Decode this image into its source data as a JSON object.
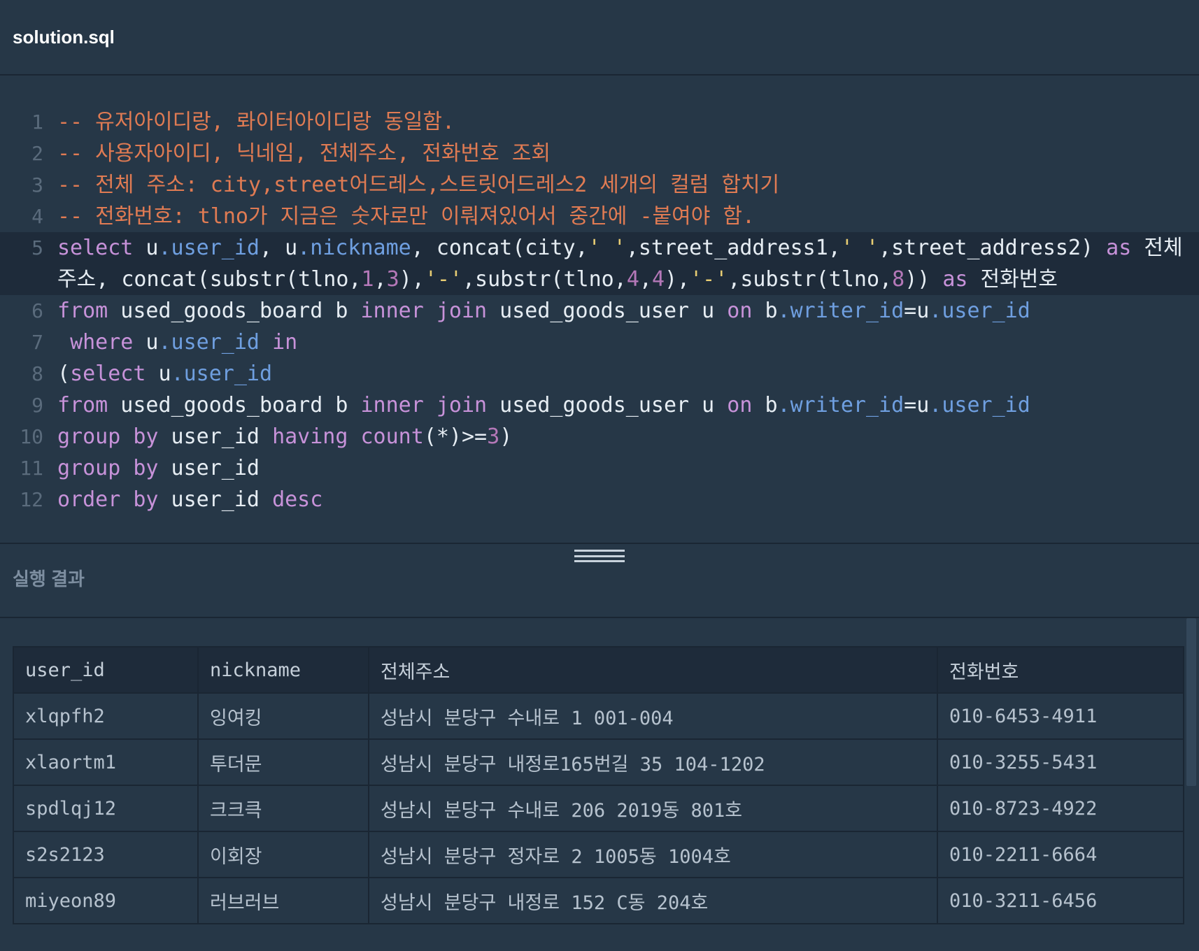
{
  "file": {
    "title": "solution.sql"
  },
  "editor": {
    "lines": [
      {
        "n": "1",
        "tokens": [
          {
            "t": "-- 유저아이디랑, 롸이터아이디랑 동일함.",
            "c": "cm"
          }
        ]
      },
      {
        "n": "2",
        "tokens": [
          {
            "t": "-- 사용자아이디, 닉네임, 전체주소, 전화번호 조회",
            "c": "cm"
          }
        ]
      },
      {
        "n": "3",
        "tokens": [
          {
            "t": "-- 전체 주소: city,street어드레스,스트릿어드레스2 세개의 컬럼 합치기",
            "c": "cm"
          }
        ]
      },
      {
        "n": "4",
        "tokens": [
          {
            "t": "-- 전화번호: tlno가 지금은 숫자로만 이뤄져있어서 중간에 -붙여야 함.",
            "c": "cm"
          }
        ]
      },
      {
        "n": "5",
        "active": true,
        "tokens": [
          {
            "t": "select",
            "c": "kw"
          },
          {
            "t": " u"
          },
          {
            "t": ".user_id",
            "c": "prop"
          },
          {
            "t": ", u"
          },
          {
            "t": ".nickname",
            "c": "prop"
          },
          {
            "t": ", concat(city,"
          },
          {
            "t": "' '",
            "c": "str"
          },
          {
            "t": ",street_address1,"
          },
          {
            "t": "' '",
            "c": "str"
          },
          {
            "t": ",street_address2) "
          },
          {
            "t": "as",
            "c": "kw"
          },
          {
            "t": " 전체주소, concat(substr(tlno,"
          },
          {
            "t": "1",
            "c": "num"
          },
          {
            "t": ","
          },
          {
            "t": "3",
            "c": "num"
          },
          {
            "t": "),"
          },
          {
            "t": "'-'",
            "c": "str"
          },
          {
            "t": ",substr(tlno,"
          },
          {
            "t": "4",
            "c": "num"
          },
          {
            "t": ","
          },
          {
            "t": "4",
            "c": "num"
          },
          {
            "t": "),"
          },
          {
            "t": "'-'",
            "c": "str"
          },
          {
            "t": ",substr(tlno,"
          },
          {
            "t": "8",
            "c": "num"
          },
          {
            "t": ")) "
          },
          {
            "t": "as",
            "c": "kw"
          },
          {
            "t": " 전화번호"
          }
        ]
      },
      {
        "n": "6",
        "tokens": [
          {
            "t": "from",
            "c": "kw"
          },
          {
            "t": " used_goods_board b "
          },
          {
            "t": "inner join",
            "c": "kw"
          },
          {
            "t": " used_goods_user u "
          },
          {
            "t": "on",
            "c": "kw"
          },
          {
            "t": " b"
          },
          {
            "t": ".writer_id",
            "c": "prop"
          },
          {
            "t": "=u"
          },
          {
            "t": ".user_id",
            "c": "prop"
          }
        ]
      },
      {
        "n": "7",
        "tokens": [
          {
            "t": " "
          },
          {
            "t": "where",
            "c": "kw"
          },
          {
            "t": " u"
          },
          {
            "t": ".user_id",
            "c": "prop"
          },
          {
            "t": " "
          },
          {
            "t": "in",
            "c": "kw"
          }
        ]
      },
      {
        "n": "8",
        "tokens": [
          {
            "t": "("
          },
          {
            "t": "select",
            "c": "kw"
          },
          {
            "t": " u"
          },
          {
            "t": ".user_id",
            "c": "prop"
          }
        ]
      },
      {
        "n": "9",
        "tokens": [
          {
            "t": "from",
            "c": "kw"
          },
          {
            "t": " used_goods_board b "
          },
          {
            "t": "inner join",
            "c": "kw"
          },
          {
            "t": " used_goods_user u "
          },
          {
            "t": "on",
            "c": "kw"
          },
          {
            "t": " b"
          },
          {
            "t": ".writer_id",
            "c": "prop"
          },
          {
            "t": "=u"
          },
          {
            "t": ".user_id",
            "c": "prop"
          }
        ]
      },
      {
        "n": "10",
        "tokens": [
          {
            "t": "group by",
            "c": "kw"
          },
          {
            "t": " user_id "
          },
          {
            "t": "having",
            "c": "kw"
          },
          {
            "t": " "
          },
          {
            "t": "count",
            "c": "kw"
          },
          {
            "t": "(*)>="
          },
          {
            "t": "3",
            "c": "num"
          },
          {
            "t": ")"
          }
        ]
      },
      {
        "n": "11",
        "tokens": [
          {
            "t": "group by",
            "c": "kw"
          },
          {
            "t": " user_id"
          }
        ]
      },
      {
        "n": "12",
        "tokens": [
          {
            "t": "order by",
            "c": "kw"
          },
          {
            "t": " user_id "
          },
          {
            "t": "desc",
            "c": "kw"
          }
        ]
      }
    ]
  },
  "results": {
    "title": "실행 결과",
    "columns": [
      "user_id",
      "nickname",
      "전체주소",
      "전화번호"
    ],
    "rows": [
      [
        "xlqpfh2",
        "잉여킹",
        "성남시 분당구 수내로 1 001-004",
        "010-6453-4911"
      ],
      [
        "xlaortm1",
        "투더문",
        "성남시 분당구 내정로165번길 35 104-1202",
        "010-3255-5431"
      ],
      [
        "spdlqj12",
        "크크큭",
        "성남시 분당구 수내로 206 2019동 801호",
        "010-8723-4922"
      ],
      [
        "s2s2123",
        "이회장",
        "성남시 분당구 정자로 2 1005동 1004호",
        "010-2211-6664"
      ],
      [
        "miyeon89",
        "러브러브",
        "성남시 분당구 내정로 152 C동 204호",
        "010-3211-6456"
      ]
    ]
  }
}
